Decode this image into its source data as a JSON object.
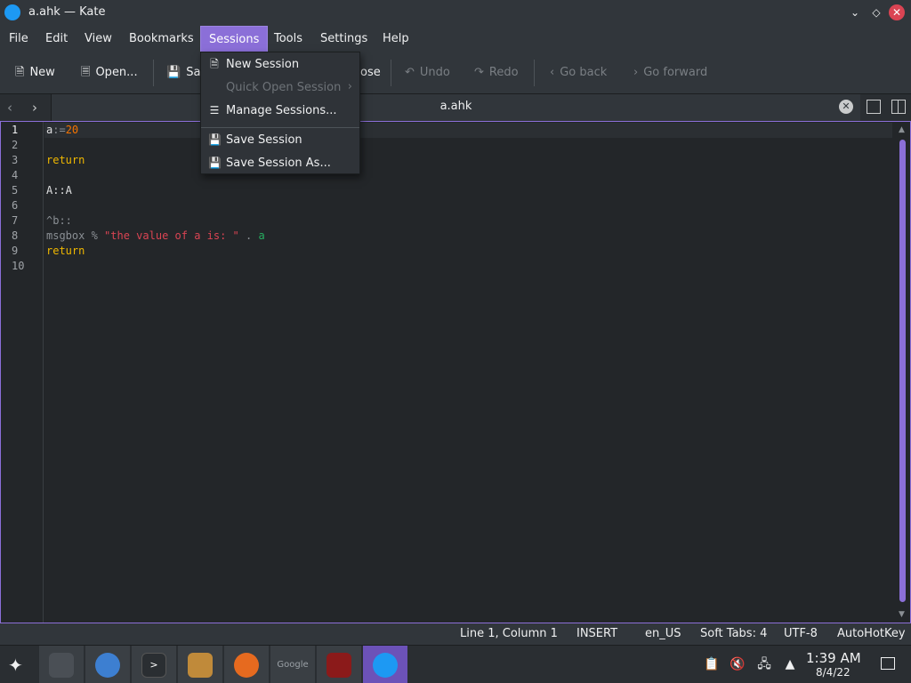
{
  "window": {
    "title": "a.ahk — Kate"
  },
  "menubar": {
    "items": [
      "File",
      "Edit",
      "View",
      "Bookmarks",
      "Sessions",
      "Tools",
      "Settings",
      "Help"
    ],
    "active": "Sessions"
  },
  "toolbar": {
    "new": "New",
    "open": "Open...",
    "save": "Sa",
    "close": "ose",
    "undo": "Undo",
    "redo": "Redo",
    "go_back": "Go back",
    "go_forward": "Go forward"
  },
  "tabs": {
    "active_title": "a.ahk"
  },
  "editor": {
    "line_numbers": [
      "1",
      "2",
      "3",
      "4",
      "5",
      "6",
      "7",
      "8",
      "9",
      "10"
    ],
    "lines": {
      "l1_var": "a",
      "l1_op": ":=",
      "l1_num": "20",
      "l3": "return",
      "l5": "A::A",
      "l7": "^b::",
      "l8_cmd": "msgbox",
      "l8_pct": " % ",
      "l8_str": "\"the value of a is: \"",
      "l8_dot": " . ",
      "l8_var": "a",
      "l9": "return"
    }
  },
  "statusbar": {
    "position": "Line 1, Column 1",
    "mode": "INSERT",
    "language": "en_US",
    "indent": "Soft Tabs: 4",
    "encoding": "UTF-8",
    "syntax": "AutoHotKey"
  },
  "sessions_menu": {
    "new_session": "New Session",
    "quick_open": "Quick Open Session",
    "manage": "Manage Sessions...",
    "save": "Save Session",
    "save_as": "Save Session As..."
  },
  "taskbar": {
    "clock_time": "1:39 AM",
    "clock_date": "8/4/22",
    "google_label": "Google"
  },
  "colors": {
    "accent": "#8b6fd8",
    "close": "#da4453"
  }
}
